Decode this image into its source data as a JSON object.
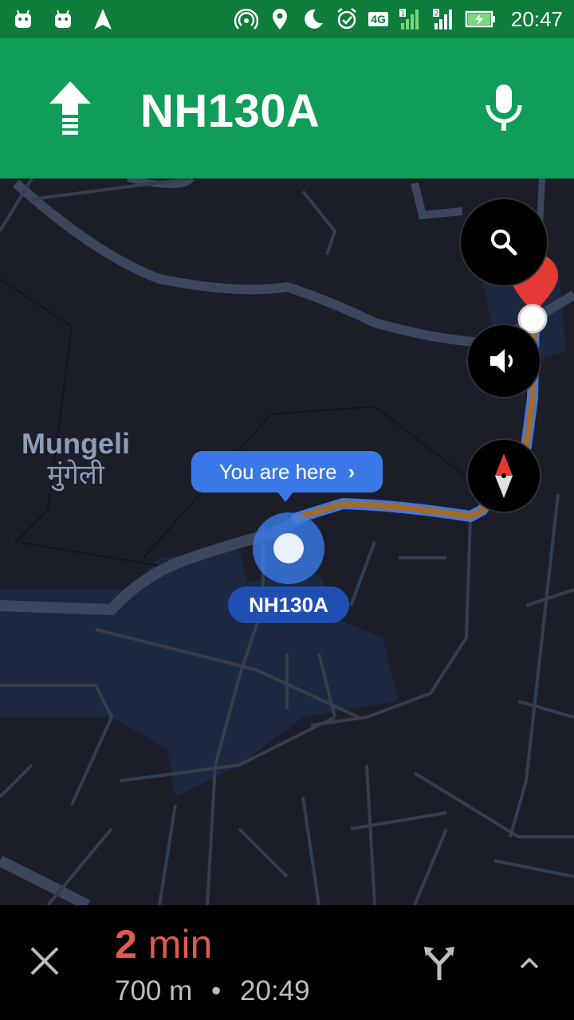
{
  "status_bar": {
    "time": "20:47",
    "network_type": "4G",
    "sim1": "1",
    "sim2": "2",
    "icons": [
      "android-icon",
      "android-icon",
      "navigation-arrow-icon",
      "hotspot-icon",
      "location-pin-icon",
      "do-not-disturb-moon-icon",
      "alarm-clock-icon",
      "signal-icon",
      "signal-icon",
      "battery-charging-icon"
    ]
  },
  "nav_header": {
    "road_name": "NH130A",
    "turn_icon": "straight-arrow-icon",
    "mic_icon": "microphone-icon",
    "background_color": "#0f9d58"
  },
  "map": {
    "place_name_en": "Mungeli",
    "place_name_hi": "मुंगेली",
    "you_are_here_label": "You are here",
    "current_road_label": "NH130A",
    "route_color": "#a26b2b",
    "accent_blue": "#3b78e7",
    "destination_pin_color": "#e53935"
  },
  "map_controls": {
    "search_icon": "search-icon",
    "sound_icon": "volume-icon",
    "compass_icon": "compass-icon"
  },
  "trip_summary": {
    "eta_value": "2",
    "eta_unit": "min",
    "distance": "700 m",
    "separator": "•",
    "arrival_time": "20:49",
    "eta_color": "#e05a4f"
  }
}
